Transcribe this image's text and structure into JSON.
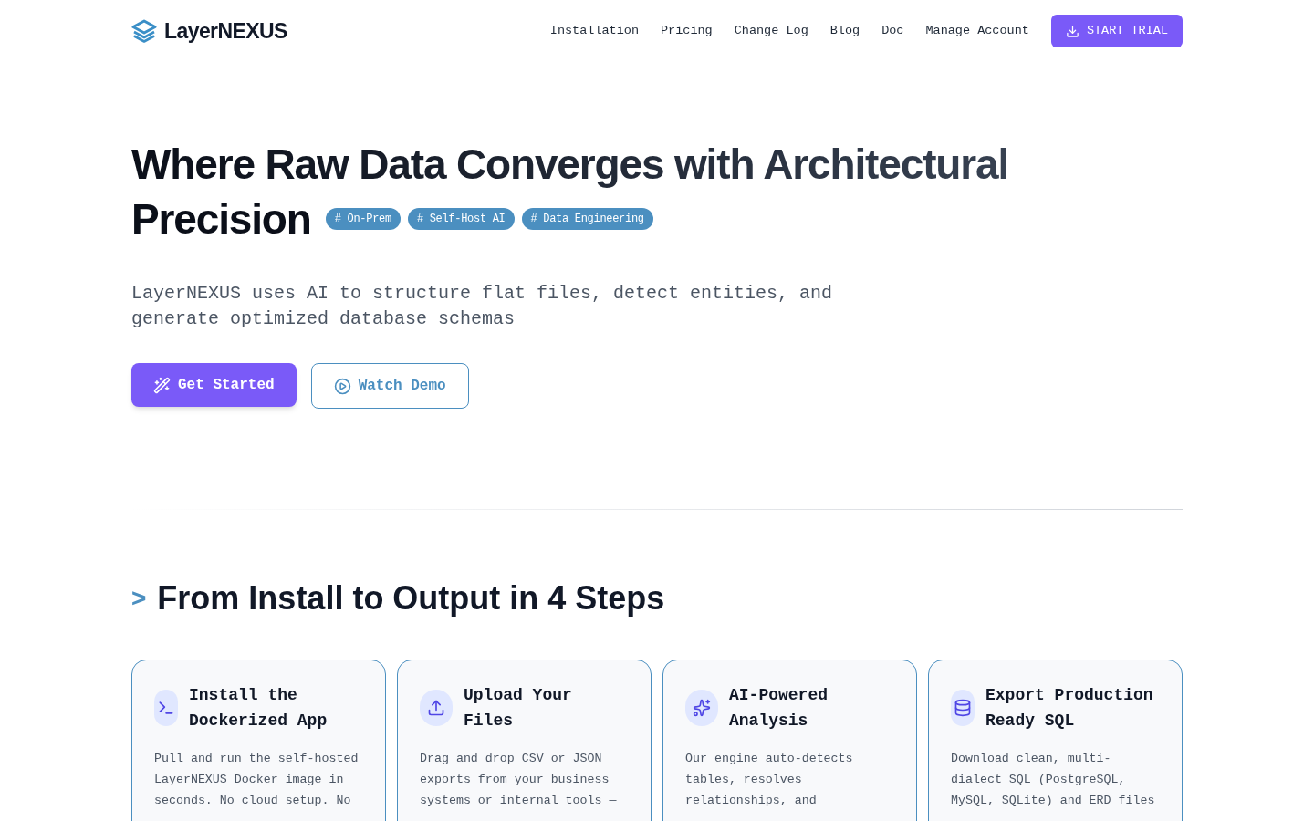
{
  "header": {
    "brand": "LayerNEXUS",
    "nav": [
      "Installation",
      "Pricing",
      "Change Log",
      "Blog",
      "Doc",
      "Manage Account"
    ],
    "cta": "START TRIAL"
  },
  "hero": {
    "title_lines": [
      "Where Raw Data Converges with Architectural",
      "Precision"
    ],
    "tags": [
      "# On-Prem",
      "# Self-Host AI",
      "# Data Engineering"
    ],
    "description": "LayerNEXUS uses AI to structure flat files, detect entities, and generate optimized database schemas",
    "primary_button": "Get Started",
    "secondary_button": "Watch Demo"
  },
  "steps": {
    "marker": ">",
    "title": "From Install to Output in 4 Steps",
    "cards": [
      {
        "kind": "terminal",
        "title": "Install the Dockerized App",
        "description": "Pull and run the self-hosted LayerNEXUS Docker image in seconds. No cloud setup. No"
      },
      {
        "kind": "upload",
        "title": "Upload Your Files",
        "description": "Drag and drop CSV or JSON exports from your business systems or internal tools —"
      },
      {
        "kind": "sparkles",
        "title": "AI-Powered Analysis",
        "description": "Our engine auto-detects tables, resolves relationships, and"
      },
      {
        "kind": "database",
        "title": "Export Production Ready SQL",
        "description": "Download clean, multi-dialect SQL (PostgreSQL, MySQL, SQLite) and ERD files"
      }
    ]
  }
}
